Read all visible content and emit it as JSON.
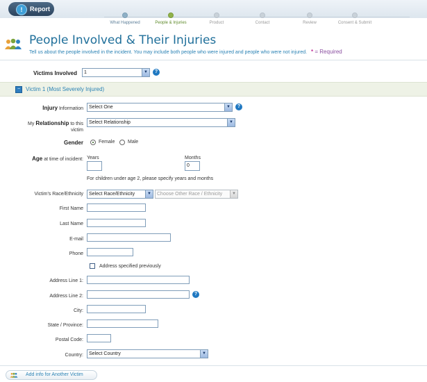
{
  "header": {
    "report_tab": "Report",
    "steps": [
      "What Happened",
      "People & Injuries",
      "Product",
      "Contact",
      "Review",
      "Consent & Submit"
    ]
  },
  "page": {
    "title": "People Involved & Their Injuries",
    "subtitle": "Tell us about the people involved in the incident. You may include both people who were injured and people who were not injured.",
    "required_mark": "*",
    "required_text": "= Required"
  },
  "victims_involved": {
    "label": "Victims Involved",
    "value": "1"
  },
  "section": {
    "title": "Victim 1 (Most Severely Injured)"
  },
  "injury": {
    "label_bold": "Injury",
    "label_rest": "Information",
    "value": "Select One"
  },
  "relationship": {
    "label_pre": "My",
    "label_bold": "Relationship",
    "label_post": "to this",
    "label_line2": "victim",
    "value": "Select Relationship"
  },
  "gender": {
    "label": "Gender",
    "options": [
      "Female",
      "Male"
    ],
    "selected": "Female"
  },
  "age": {
    "label_bold": "Age",
    "label_rest": "at time of incident:",
    "years_label": "Years",
    "years_value": "",
    "months_label": "Months",
    "months_value": "0",
    "note": "For children under age 2, please specify years and months"
  },
  "race": {
    "label": "Victim's Race/Ethnicity",
    "value": "Select Race/Ethnicity",
    "other_value": "Choose Other Race / Ethnicity"
  },
  "fields": {
    "first_name": "First Name",
    "last_name": "Last Name",
    "email": "E-mail",
    "phone": "Phone",
    "address_prev": "Address specified previously",
    "address1": "Address Line 1:",
    "address2": "Address Line 2:",
    "city": "City:",
    "state": "State / Province:",
    "postal": "Postal Code:",
    "country": "Country:",
    "country_value": "Select Country"
  },
  "add_victim": "Add info for Another Victim"
}
